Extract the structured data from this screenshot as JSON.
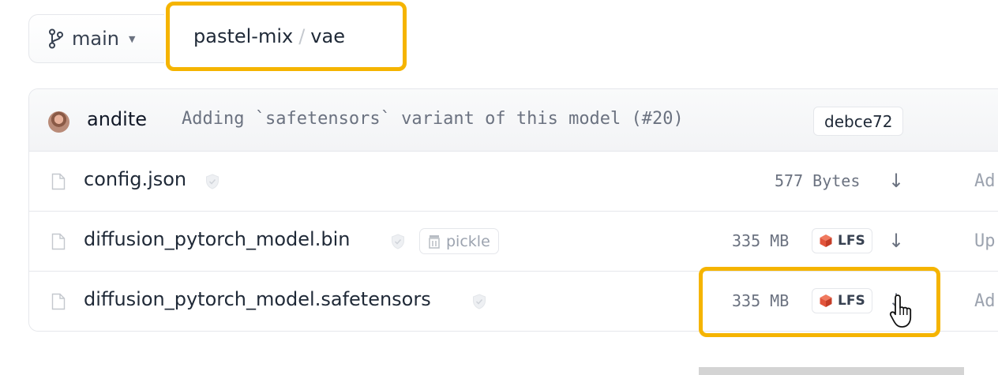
{
  "header": {
    "branch_label": "main",
    "path_repo": "pastel-mix",
    "path_separator": "/",
    "path_folder": "vae"
  },
  "commit": {
    "author": "andite",
    "message": "Adding `safetensors` variant of this model (#20)",
    "hash": "debce72"
  },
  "files": [
    {
      "name": "config.json",
      "size": "577 Bytes",
      "lfs": false,
      "cut_text": "Ad"
    },
    {
      "name": "diffusion_pytorch_model.bin",
      "size": "335 MB",
      "lfs": true,
      "lfs_label": "LFS",
      "pickle_label": "pickle",
      "cut_text": "Up"
    },
    {
      "name": "diffusion_pytorch_model.safetensors",
      "size": "335 MB",
      "lfs": true,
      "lfs_label": "LFS",
      "cut_text": "Ad"
    }
  ],
  "icons": {
    "branch": "branch-icon",
    "file": "file-icon",
    "shield": "shield-check-icon",
    "download": "download-arrow-icon",
    "lfs": "lfs-cube-icon",
    "pickle": "pickle-jar-icon",
    "cursor": "hand-pointer-cursor-icon"
  },
  "colors": {
    "highlight": "#f5b400",
    "lfs_cube": "#e2553c",
    "text_muted": "#6b7280"
  }
}
